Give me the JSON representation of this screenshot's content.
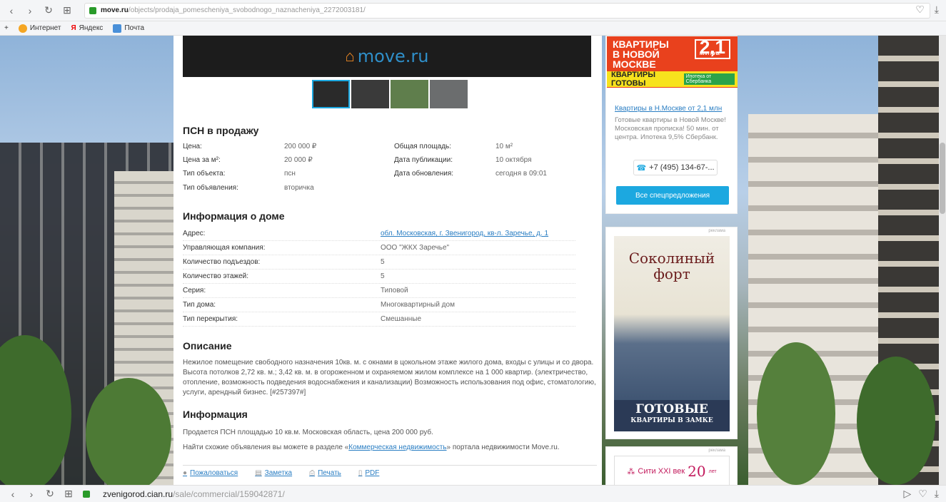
{
  "browser": {
    "url_domain": "move.ru",
    "url_path": "/objects/prodaja_pomescheniya_svobodnogo_naznacheniya_2272003181/",
    "bookmarks": [
      "Интернет",
      "Яндекс",
      "Почта"
    ],
    "bottom_url_domain": "zvenigorod.cian.ru",
    "bottom_url_path": "/sale/commercial/159042871/"
  },
  "listing": {
    "hero_logo": "move.ru",
    "title": "ПСН в продажу",
    "left_details": [
      {
        "label": "Цена:",
        "value": "200 000 ₽"
      },
      {
        "label": "Цена за м²:",
        "value": "20 000 ₽"
      },
      {
        "label": "Тип объекта:",
        "value": "псн"
      },
      {
        "label": "Тип объявления:",
        "value": "вторичка"
      }
    ],
    "right_details": [
      {
        "label": "Общая площадь:",
        "value": "10 м²"
      },
      {
        "label": "Дата публикации:",
        "value": "10 октября"
      },
      {
        "label": "Дата обновления:",
        "value": "сегодня в 09:01"
      }
    ]
  },
  "house": {
    "title": "Информация о доме",
    "rows": [
      {
        "label": "Адрес:",
        "value": "обл. Московская, г. Звенигород, кв-л. Заречье, д. 1"
      },
      {
        "label": "Управляющая компания:",
        "value": "ООО \"ЖКХ Заречье\""
      },
      {
        "label": "Количество подъездов:",
        "value": "5"
      },
      {
        "label": "Количество этажей:",
        "value": "5"
      },
      {
        "label": "Серия:",
        "value": "Типовой"
      },
      {
        "label": "Тип дома:",
        "value": "Многоквартирный дом"
      },
      {
        "label": "Тип перекрытия:",
        "value": "Смешанные"
      }
    ]
  },
  "description": {
    "title": "Описание",
    "text": "Нежилое помещение свободного назначения 10кв. м. с окнами в цокольном этаже жилого дома, входы с улицы и со двора. Высота потолков 2,72 кв. м.; 3,42 кв. м. в огороженном и охраняемом жилом комплексе на 1 000 квартир. (электричество, отопление, возможность подведения водоснабжения и канализации) Возможность использования под офис, стоматологию, услуги, арендный бизнес. [#257397#]"
  },
  "info": {
    "title": "Информация",
    "line1": "Продается ПСН площадью 10 кв.м. Московская область, цена 200 000 руб.",
    "line2_prefix": "Найти схожие объявления вы можете в разделе «",
    "line2_link": "Коммерческая недвижимость",
    "line2_suffix": "» портала недвижимости Move.ru."
  },
  "actions": {
    "complain": "Пожаловаться",
    "note": "Заметка",
    "print": "Печать",
    "pdf": "PDF"
  },
  "sidebar": {
    "promo1": {
      "banner_line1": "КВАРТИРЫ",
      "banner_line2": "В НОВОЙ",
      "banner_line3": "МОСКВЕ",
      "banner_price": "2,1",
      "banner_price_unit": "МЛН РУБ.",
      "banner_bar": "КВАРТИРЫ ГОТОВЫ",
      "banner_badge": "Ипотека от Сбербанка",
      "link": "Квартиры в Н.Москве от 2,1 млн",
      "text": "Готовые квартиры в Новой Москве! Московская прописка! 50 мин. от центра. Ипотека 9,5% Сбербанк.",
      "phone": "+7 (495) 134-67-...",
      "all_button": "Все спецпредложения"
    },
    "ad_label": "реклама",
    "promo2": {
      "title_line1": "Соколиный",
      "title_line2": "форт",
      "bottom_big": "ГОТОВЫЕ",
      "bottom_small": "КВАРТИРЫ В ЗАМКЕ"
    },
    "promo3": {
      "name": "Сити XXI век",
      "years": "20",
      "years_suffix": "лет"
    }
  }
}
